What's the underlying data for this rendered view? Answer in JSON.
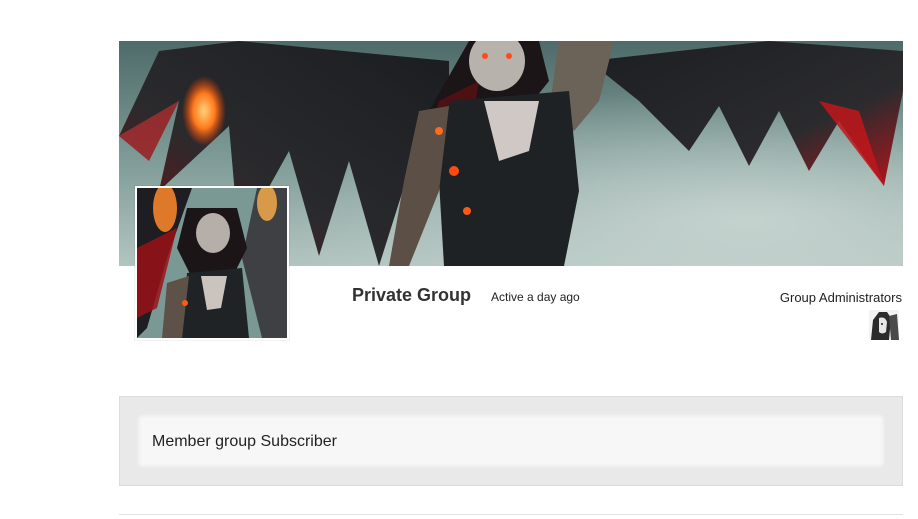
{
  "group": {
    "status": "Private Group",
    "last_active": "Active a day ago"
  },
  "admins": {
    "title": "Group Administrators"
  },
  "member_panel": {
    "text": "Member group Subscriber"
  },
  "icons": {
    "cover": "cover-image",
    "avatar": "group-avatar-image",
    "admin": "admin-avatar-image"
  },
  "colors": {
    "panel_bg": "#e9e9e9",
    "panel_inner": "#f7f7f7",
    "text": "#222222",
    "wing_red": "#c0161b"
  }
}
